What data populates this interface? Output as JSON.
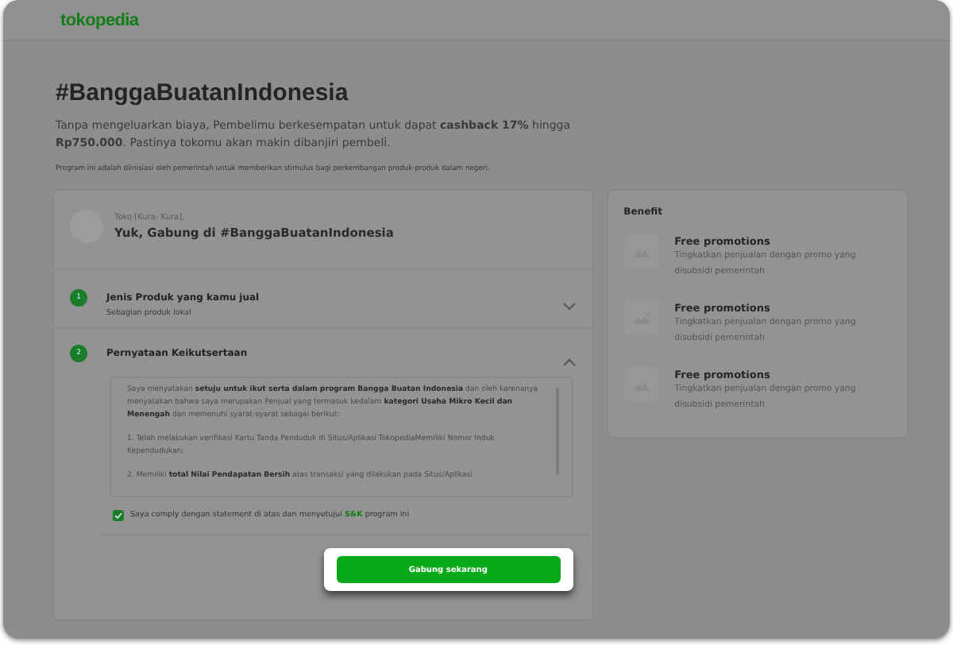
{
  "header": {
    "logo": "tokopedia"
  },
  "hero": {
    "title": "#BanggaBuatanIndonesia",
    "description": "Tanpa mengeluarkan biaya, Pembelimu berkesempatan untuk dapat **cashback 17%** hingga **Rp750.000**. Pastinya tokomu akan makin dibanjiri pembeli.",
    "note": "Program ini adalah diinisiasi oleh pemerintah untuk memberikan stimulus bagi perkembangan produk-produk dalam negeri."
  },
  "form": {
    "shop_label": "Toko [Kura- Kura],",
    "greeting": "Yuk, Gabung di #BanggaBuatanIndonesia",
    "steps": [
      {
        "number": "1",
        "title": "Jenis Produk yang kamu jual",
        "subtitle": "Sebagian produk lokal",
        "expanded": false
      },
      {
        "number": "2",
        "title": "Pernyataan Keikutsertaan",
        "expanded": true
      }
    ],
    "statement": [
      "Saya menyatakan **setuju untuk ikut serta dalam program Bangga Buatan Indonesia** dan oleh karenanya menyatakan bahwa saya merupakan Penjual yang termasuk kedalam **kategori Usaha Mikro Kecil dan Menengah** dan memenuhi syarat-syarat sebagai berikut:",
      "1. Telah melakukan verifikasi Kartu Tanda Penduduk di Situs/Aplikasi TokopediaMemiliki Nomor Induk Kependudukan;",
      "2. Memiliki **total Nilai Pendapatan Bersih** atas transaksi yang dilakukan pada Situs/Aplikasi"
    ],
    "agreement": {
      "checked": true,
      "text": "Saya comply dengan statement di atas dan menyetujui",
      "link": "S&K",
      "text_after": "program ini"
    },
    "submit": "Gabung sekarang"
  },
  "benefits": {
    "title": "Benefit",
    "items": [
      {
        "title": "Free promotions",
        "description": "Tingkatkan penjualan dengan promo yang disubsidi pemerintah"
      },
      {
        "title": "Free promotions",
        "description": "Tingkatkan penjualan dengan promo yang disubsidi pemerintah"
      },
      {
        "title": "Free promotions",
        "description": "Tingkatkan penjualan dengan promo yang disubsidi pemerintah"
      }
    ]
  }
}
